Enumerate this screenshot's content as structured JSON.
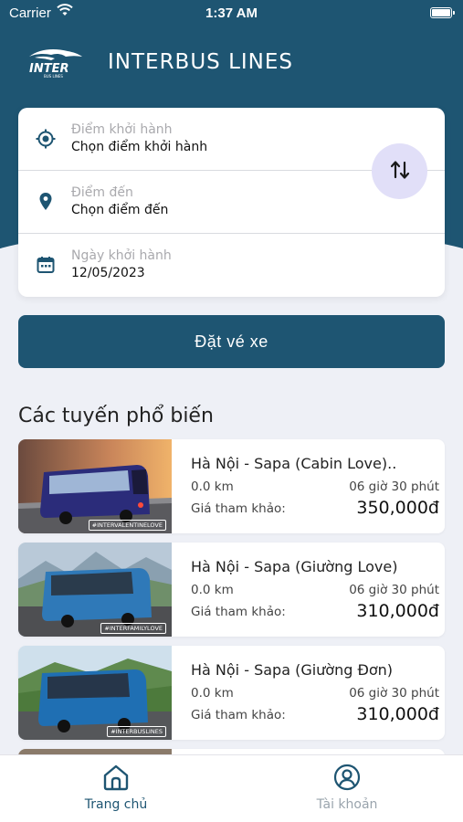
{
  "status_bar": {
    "carrier": "Carrier",
    "time": "1:37 AM"
  },
  "header": {
    "logo_text": "INTER",
    "title": "INTERBUS LINES"
  },
  "search": {
    "departure": {
      "label": "Điểm khởi hành",
      "value": "Chọn điểm khởi hành",
      "icon": "location-target-icon"
    },
    "destination": {
      "label": "Điểm đến",
      "value": "Chọn điểm đến",
      "icon": "map-pin-icon"
    },
    "date": {
      "label": "Ngày khởi hành",
      "value": "12/05/2023",
      "icon": "calendar-icon"
    },
    "swap_icon": "swap-vertical-icon"
  },
  "book_button": "Đặt vé xe",
  "popular": {
    "title": "Các tuyến phổ biến",
    "routes": [
      {
        "name": "Hà Nội - Sapa (Cabin Love)..",
        "distance": "0.0 km",
        "duration": "06 giờ 30 phút",
        "price_label": "Giá tham khảo:",
        "price": "350,000đ",
        "tag": "#INTERVALENTINELOVE"
      },
      {
        "name": "Hà Nội - Sapa (Giường Love)",
        "distance": "0.0 km",
        "duration": "06 giờ 30 phút",
        "price_label": "Giá tham khảo:",
        "price": "310,000đ",
        "tag": "#INTERFAMILYLOVE"
      },
      {
        "name": "Hà Nội - Sapa (Giường Đơn)",
        "distance": "0.0 km",
        "duration": "06 giờ 30 phút",
        "price_label": "Giá tham khảo:",
        "price": "310,000đ",
        "tag": "#INTERBUSLINES"
      }
    ]
  },
  "tabs": {
    "home": {
      "label": "Trang chủ",
      "icon": "home-icon",
      "active": true
    },
    "account": {
      "label": "Tài khoản",
      "icon": "user-icon",
      "active": false
    }
  },
  "colors": {
    "primary": "#1e5572",
    "swap_bg": "#e1dff8",
    "background": "#eef0f6"
  }
}
